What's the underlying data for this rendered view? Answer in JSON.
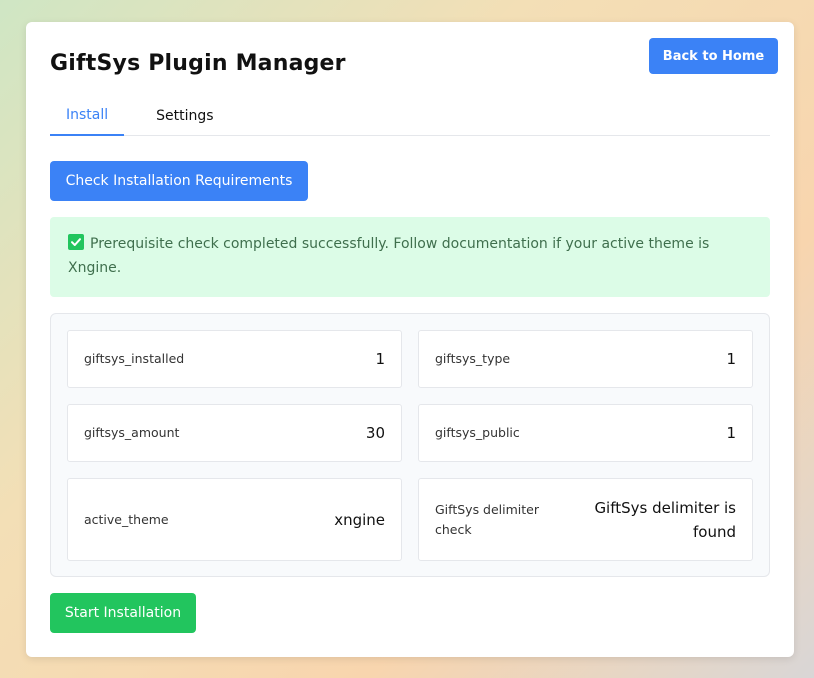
{
  "header": {
    "title": "GiftSys Plugin Manager",
    "back_label": "Back to Home"
  },
  "tabs": [
    {
      "label": "Install",
      "active": true
    },
    {
      "label": "Settings",
      "active": false
    }
  ],
  "actions": {
    "check_label": "Check Installation Requirements",
    "start_label": "Start Installation"
  },
  "alert": {
    "icon": "checkbox-checked-icon",
    "text": "Prerequisite check completed successfully. Follow documentation if your active theme is Xngine."
  },
  "results": [
    {
      "key": "giftsys_installed",
      "value": "1"
    },
    {
      "key": "giftsys_type",
      "value": "1"
    },
    {
      "key": "giftsys_amount",
      "value": "30"
    },
    {
      "key": "giftsys_public",
      "value": "1"
    },
    {
      "key": "active_theme",
      "value": "xngine"
    },
    {
      "key": "GiftSys delimiter check",
      "value": "GiftSys delimiter is found"
    }
  ],
  "colors": {
    "primary": "#3b82f6",
    "success": "#22c55e",
    "alert_bg": "#dcfce7",
    "alert_text": "#3f6f4d"
  }
}
